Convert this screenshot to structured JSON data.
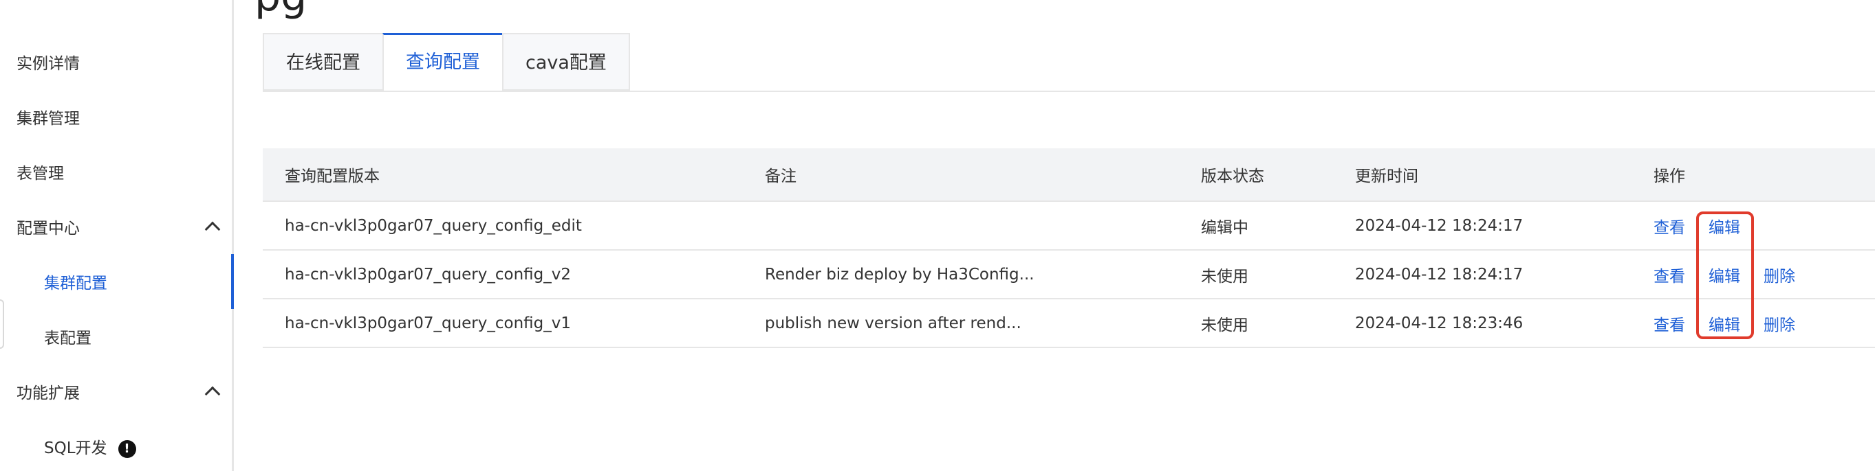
{
  "header": {
    "title_fragment": "pg"
  },
  "sidebar": {
    "items": [
      {
        "label": "实例详情"
      },
      {
        "label": "集群管理"
      },
      {
        "label": "表管理"
      },
      {
        "label": "配置中心",
        "expanded": true,
        "children": [
          {
            "label": "集群配置",
            "active": true
          },
          {
            "label": "表配置"
          }
        ]
      },
      {
        "label": "功能扩展",
        "expanded": true,
        "children": [
          {
            "label": "SQL开发",
            "badge": "!"
          }
        ]
      }
    ]
  },
  "tabs": [
    {
      "label": "在线配置"
    },
    {
      "label": "查询配置",
      "active": true
    },
    {
      "label": "cava配置"
    }
  ],
  "table": {
    "headers": [
      "查询配置版本",
      "备注",
      "版本状态",
      "更新时间",
      "操作"
    ],
    "rows": [
      {
        "version": "ha-cn-vkl3p0gar07_query_config_edit",
        "note": "",
        "status": "编辑中",
        "updated": "2024-04-12 18:24:17",
        "actions": [
          "查看",
          "编辑"
        ]
      },
      {
        "version": "ha-cn-vkl3p0gar07_query_config_v2",
        "note": "Render biz deploy by Ha3Config...",
        "status": "未使用",
        "updated": "2024-04-12 18:24:17",
        "actions": [
          "查看",
          "编辑",
          "删除"
        ]
      },
      {
        "version": "ha-cn-vkl3p0gar07_query_config_v1",
        "note": "publish new version after rend...",
        "status": "未使用",
        "updated": "2024-04-12 18:23:46",
        "actions": [
          "查看",
          "编辑",
          "删除"
        ]
      }
    ]
  },
  "colors": {
    "accent": "#1e5fd6",
    "highlight": "#e03b2c",
    "header_bg": "#f2f3f5",
    "border": "#e6e6e6"
  }
}
